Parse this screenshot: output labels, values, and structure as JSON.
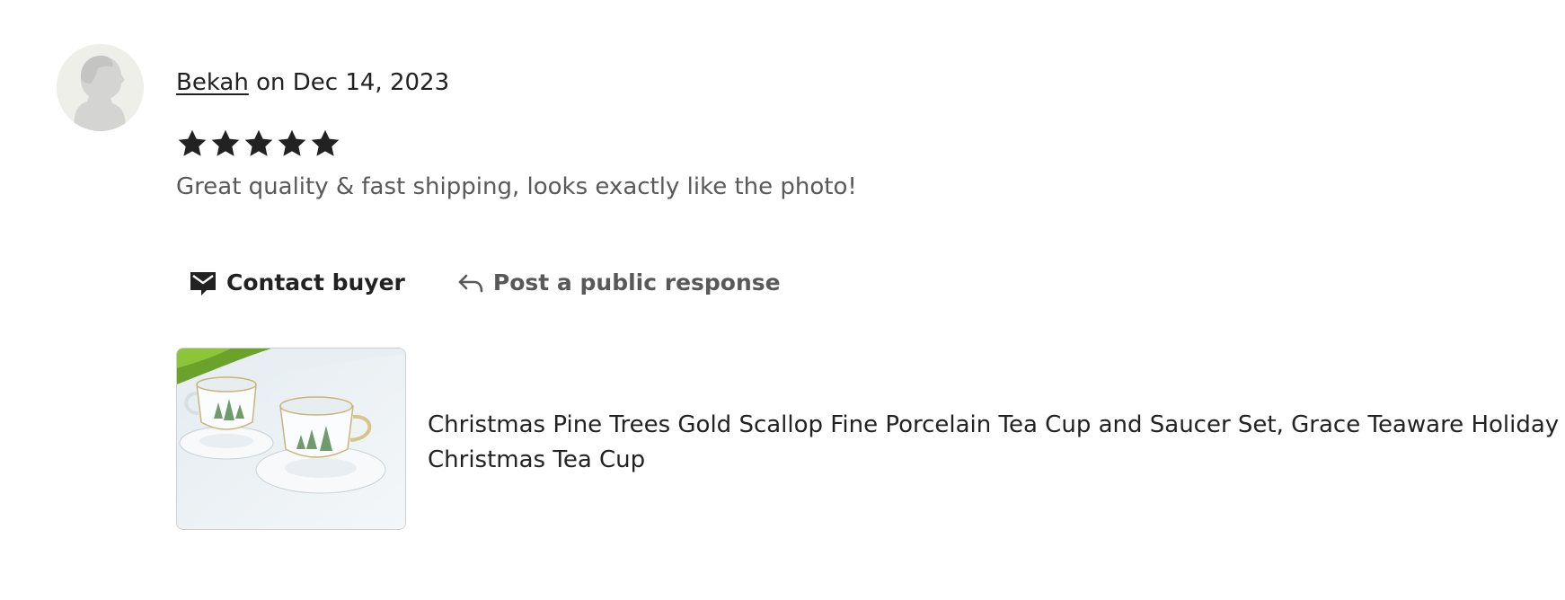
{
  "review": {
    "reviewer_name": "Bekah",
    "date_text": " on Dec 14, 2023",
    "rating": 5,
    "rating_max": 5,
    "text": "Great quality & fast shipping, looks exactly like the photo!"
  },
  "actions": {
    "contact_label": "Contact buyer",
    "respond_label": "Post a public response"
  },
  "listing": {
    "title": "Christmas Pine Trees Gold Scallop Fine Porcelain Tea Cup and Saucer Set, Grace Teaware Holiday Christmas Tea Cup"
  },
  "icons": {
    "avatar": "default-user-avatar-icon",
    "star": "star-icon",
    "contact": "envelope-chat-icon",
    "respond": "reply-arrow-icon"
  },
  "colors": {
    "text": "#222222",
    "muted_text": "#595959",
    "avatar_bg": "#efefe9",
    "star": "#222222"
  }
}
